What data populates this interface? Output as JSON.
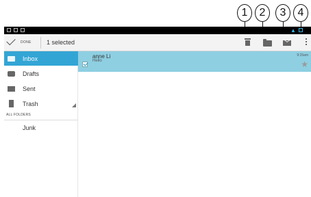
{
  "callouts": [
    "1",
    "2",
    "3",
    "4"
  ],
  "actionbar": {
    "done_label": "DONE",
    "selected_text": "1 selected"
  },
  "sidebar": {
    "items": [
      {
        "label": "Inbox",
        "icon": "inbox-icon",
        "active": true
      },
      {
        "label": "Drafts",
        "icon": "drafts-icon",
        "active": false
      },
      {
        "label": "Sent",
        "icon": "sent-icon",
        "active": false
      },
      {
        "label": "Trash",
        "icon": "trash-icon",
        "active": false
      }
    ],
    "section_header": "ALL FOLDERS",
    "folders": [
      {
        "label": "Junk"
      }
    ]
  },
  "messages": [
    {
      "sender": "anne Li",
      "snippet": "Hello",
      "time": "9:15am",
      "checked": true,
      "starred": false
    }
  ],
  "colors": {
    "accent": "#33a5d5",
    "selected_row": "#8ecfe2",
    "status_bar": "#000000"
  }
}
